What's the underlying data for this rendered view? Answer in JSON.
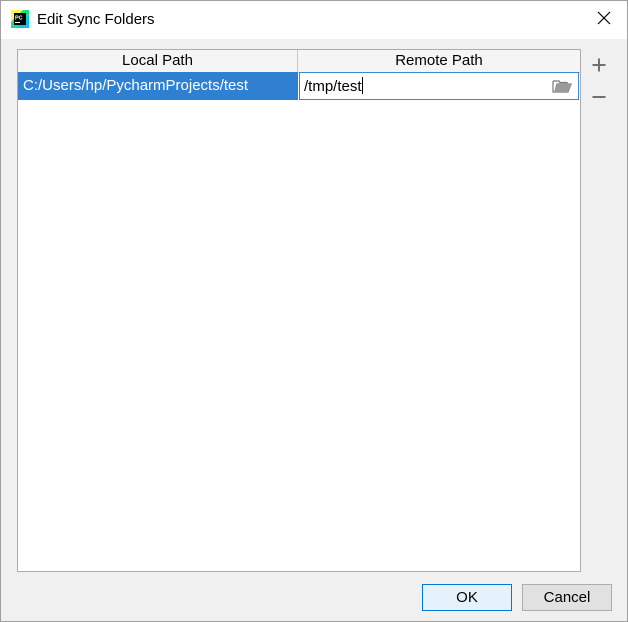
{
  "window": {
    "title": "Edit Sync Folders",
    "app_icon": "pycharm-icon",
    "app_icon_text": "PC",
    "close_icon": "close-icon"
  },
  "table": {
    "columns": [
      {
        "label": "Local Path"
      },
      {
        "label": "Remote Path"
      }
    ],
    "rows": [
      {
        "local_path": "C:/Users/hp/PycharmProjects/test",
        "remote_path": "/tmp/test",
        "selected": true,
        "editing_column": "remote"
      }
    ],
    "remote_browse_icon": "folder-open-icon"
  },
  "side_toolbar": {
    "add_icon": "plus-icon",
    "remove_icon": "minus-icon"
  },
  "buttons": {
    "ok_label": "OK",
    "cancel_label": "Cancel"
  },
  "colors": {
    "selection": "#2f80d1",
    "focus_border": "#0078d7",
    "dialog_bg": "#f0f0f0"
  }
}
